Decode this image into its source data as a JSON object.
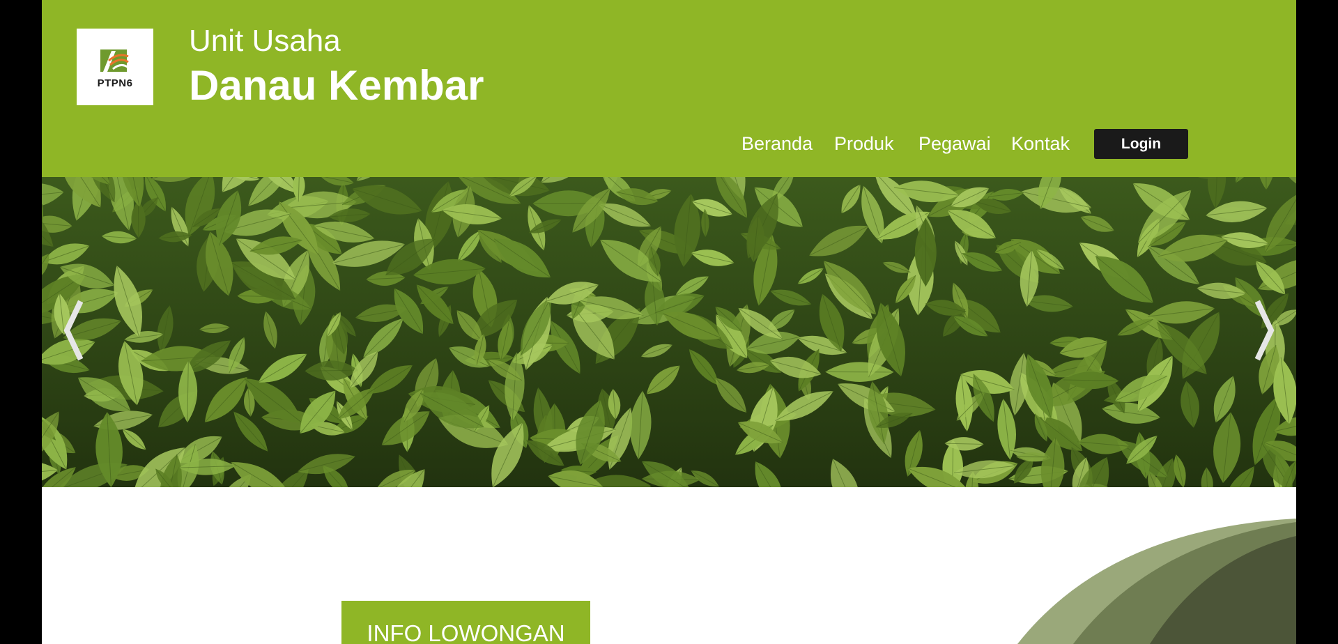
{
  "header": {
    "logo_text": "PTPN6",
    "title_line1": "Unit Usaha",
    "title_line2": "Danau Kembar"
  },
  "nav": {
    "items": [
      {
        "label": "Beranda"
      },
      {
        "label": "Produk"
      },
      {
        "label": "Pegawai"
      },
      {
        "label": "Kontak"
      }
    ],
    "login_label": "Login"
  },
  "carousel": {
    "prev_icon": "chevron-left-icon",
    "next_icon": "chevron-right-icon"
  },
  "content": {
    "info_button_label": "INFO LOWONGAN"
  },
  "colors": {
    "brand_green": "#8fb626",
    "login_bg": "#1a1a1a",
    "arc_light": "#9aa87a",
    "arc_mid": "#6f7d52",
    "arc_dark": "#4c5538"
  }
}
